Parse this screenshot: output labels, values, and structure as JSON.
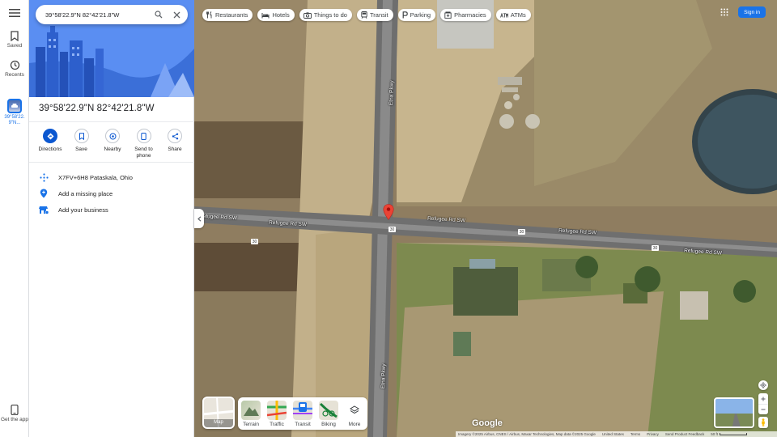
{
  "search": {
    "value": "39°58'22.9\"N 82°42'21.8\"W"
  },
  "rail": {
    "saved_label": "Saved",
    "recents_label": "Recents",
    "recent_item_label": "39°58'22.9\"N...",
    "get_app_label": "Get the app"
  },
  "place": {
    "title": "39°58'22.9\"N 82°42'21.8\"W",
    "actions": [
      {
        "label": "Directions"
      },
      {
        "label": "Save"
      },
      {
        "label": "Nearby"
      },
      {
        "label": "Send to phone"
      },
      {
        "label": "Share"
      }
    ],
    "plus_code": "X7FV+6H8 Pataskala, Ohio",
    "add_missing_place": "Add a missing place",
    "add_business": "Add your business"
  },
  "chips": [
    {
      "label": "Restaurants",
      "icon": "fork-knife-icon"
    },
    {
      "label": "Hotels",
      "icon": "bed-icon"
    },
    {
      "label": "Things to do",
      "icon": "camera-icon"
    },
    {
      "label": "Transit",
      "icon": "train-icon"
    },
    {
      "label": "Parking",
      "icon": "parking-icon"
    },
    {
      "label": "Pharmacies",
      "icon": "pharmacy-icon"
    },
    {
      "label": "ATMs",
      "icon": "atm-icon"
    }
  ],
  "header": {
    "sign_in": "Sign in"
  },
  "layers": {
    "current": "Map",
    "options": [
      {
        "label": "Terrain"
      },
      {
        "label": "Traffic"
      },
      {
        "label": "Transit"
      },
      {
        "label": "Biking"
      },
      {
        "label": "More"
      }
    ]
  },
  "map": {
    "streets": [
      {
        "label": "Etna Pkwy"
      },
      {
        "label": "Refugee Rd SW"
      },
      {
        "label": "Refugee Rd SW"
      },
      {
        "label": "Refugee Rd SW"
      },
      {
        "label": "Refugee Rd SW"
      },
      {
        "label": "Refugee Rd SW"
      },
      {
        "label": "Etna Pkwy"
      }
    ],
    "route_shields": [
      "30",
      "30",
      "30",
      "30"
    ],
    "logo": "Google"
  },
  "footer": {
    "imagery": "Imagery ©2025 Airbus, CNES / Airbus, Maxar Technologies, Map data ©2025 Google",
    "country": "United States",
    "terms": "Terms",
    "privacy": "Privacy",
    "feedback": "Send Product Feedback",
    "scale": "50 ft"
  },
  "colors": {
    "accent": "#1a73e8",
    "action_blue": "#0b57d0",
    "pin": "#ea4335"
  }
}
